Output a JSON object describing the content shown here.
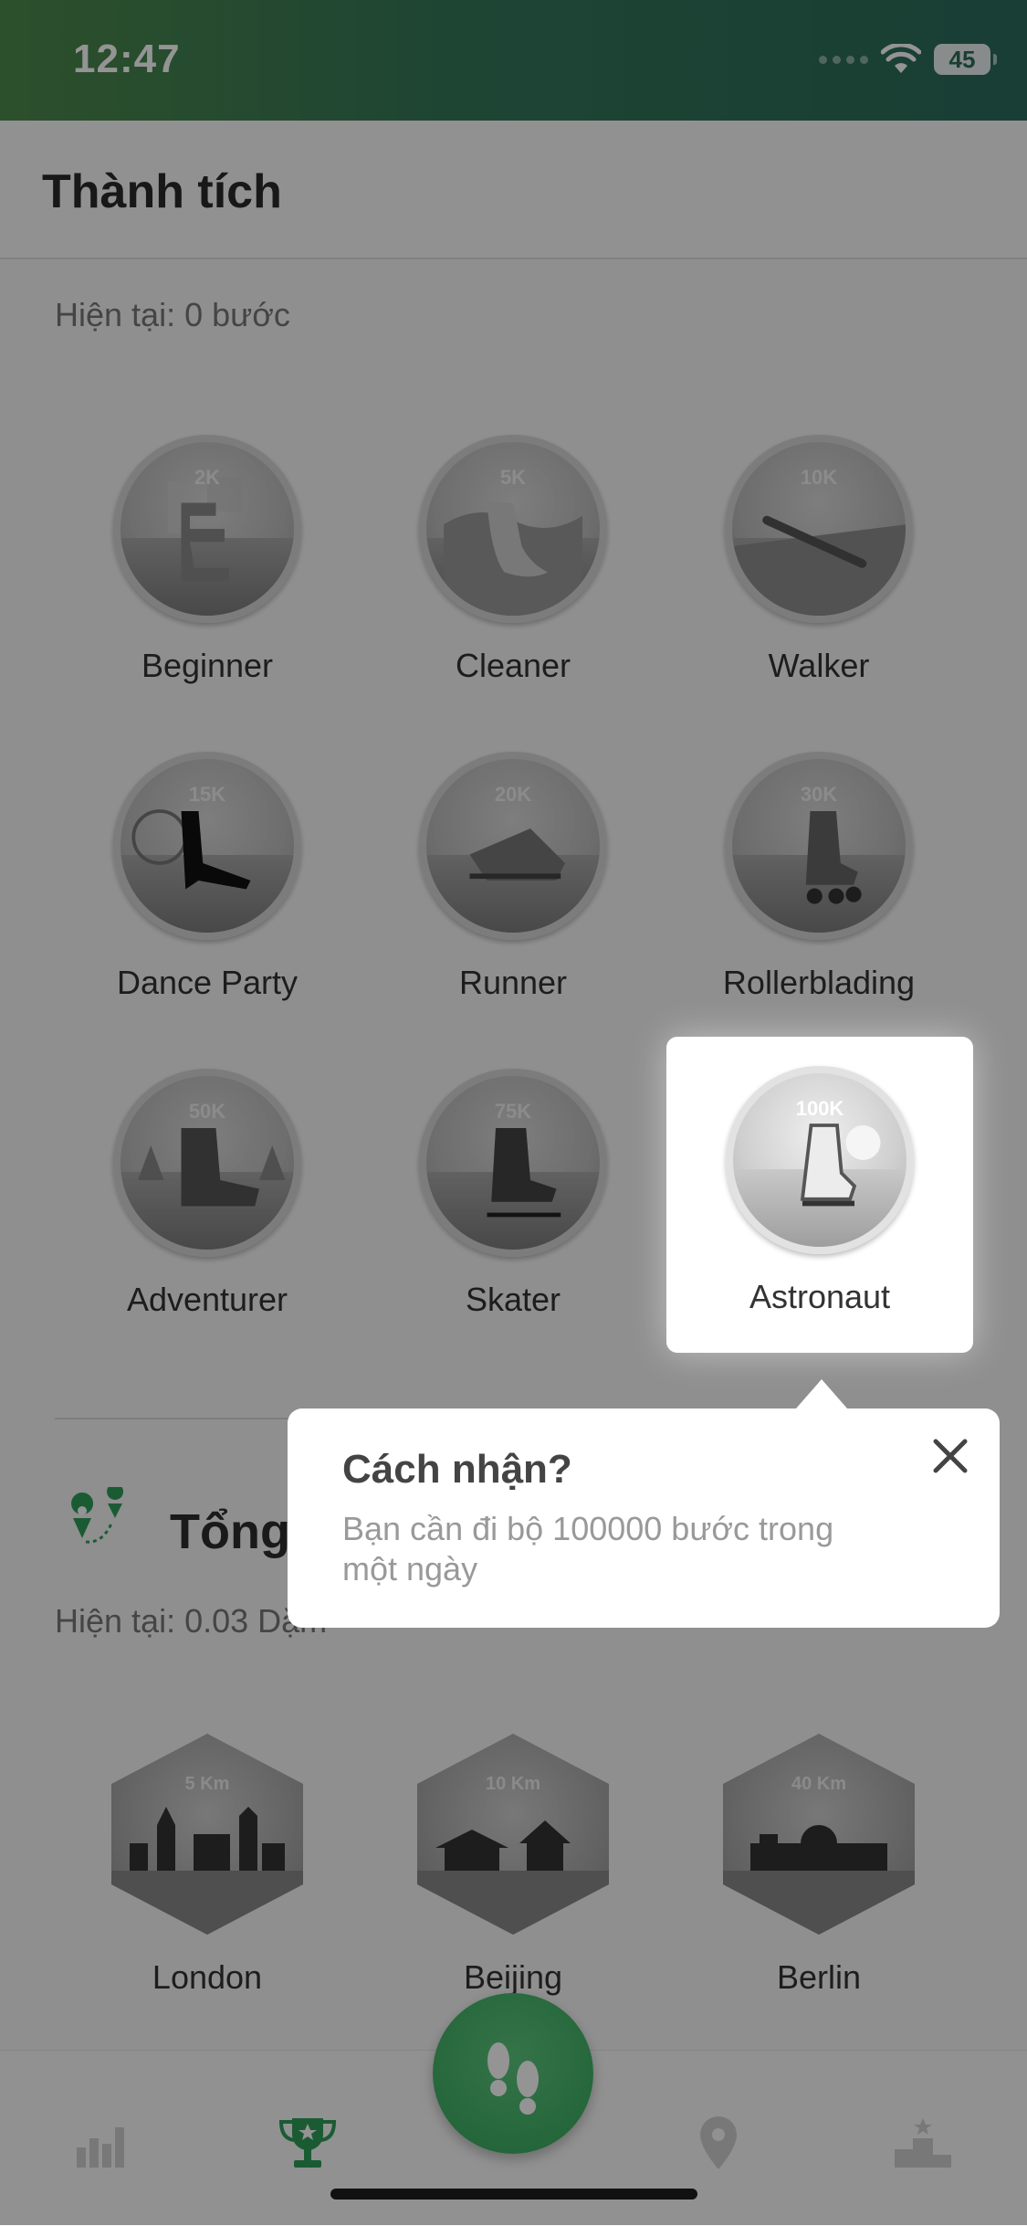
{
  "status_bar": {
    "time": "12:47",
    "battery": "45"
  },
  "header": {
    "title": "Thành tích"
  },
  "steps_section": {
    "current_label": "Hiện tại: 0 bước",
    "badges": [
      {
        "goal": "2K",
        "label": "Beginner"
      },
      {
        "goal": "5K",
        "label": "Cleaner"
      },
      {
        "goal": "10K",
        "label": "Walker"
      },
      {
        "goal": "15K",
        "label": "Dance Party"
      },
      {
        "goal": "20K",
        "label": "Runner"
      },
      {
        "goal": "30K",
        "label": "Rollerblading"
      },
      {
        "goal": "50K",
        "label": "Adventurer"
      },
      {
        "goal": "75K",
        "label": "Skater"
      },
      {
        "goal": "100K",
        "label": "Astronaut"
      }
    ]
  },
  "distance_section": {
    "title": "Tổng",
    "current_label": "Hiện tại: 0.03 Dặm",
    "badges": [
      {
        "goal": "5 Km",
        "label": "London"
      },
      {
        "goal": "10 Km",
        "label": "Beijing"
      },
      {
        "goal": "40 Km",
        "label": "Berlin"
      }
    ]
  },
  "popover": {
    "title": "Cách nhận?",
    "body": "Bạn cần đi bộ 100000 bước trong một ngày"
  },
  "tabs": [
    "stats-icon",
    "trophy-icon",
    "footsteps-icon",
    "location-pin-icon",
    "podium-icon"
  ],
  "colors": {
    "accent_green": "#2f9e5a",
    "status_gradient_start": "#4d8a4b",
    "status_gradient_end": "#2b6b5c"
  }
}
